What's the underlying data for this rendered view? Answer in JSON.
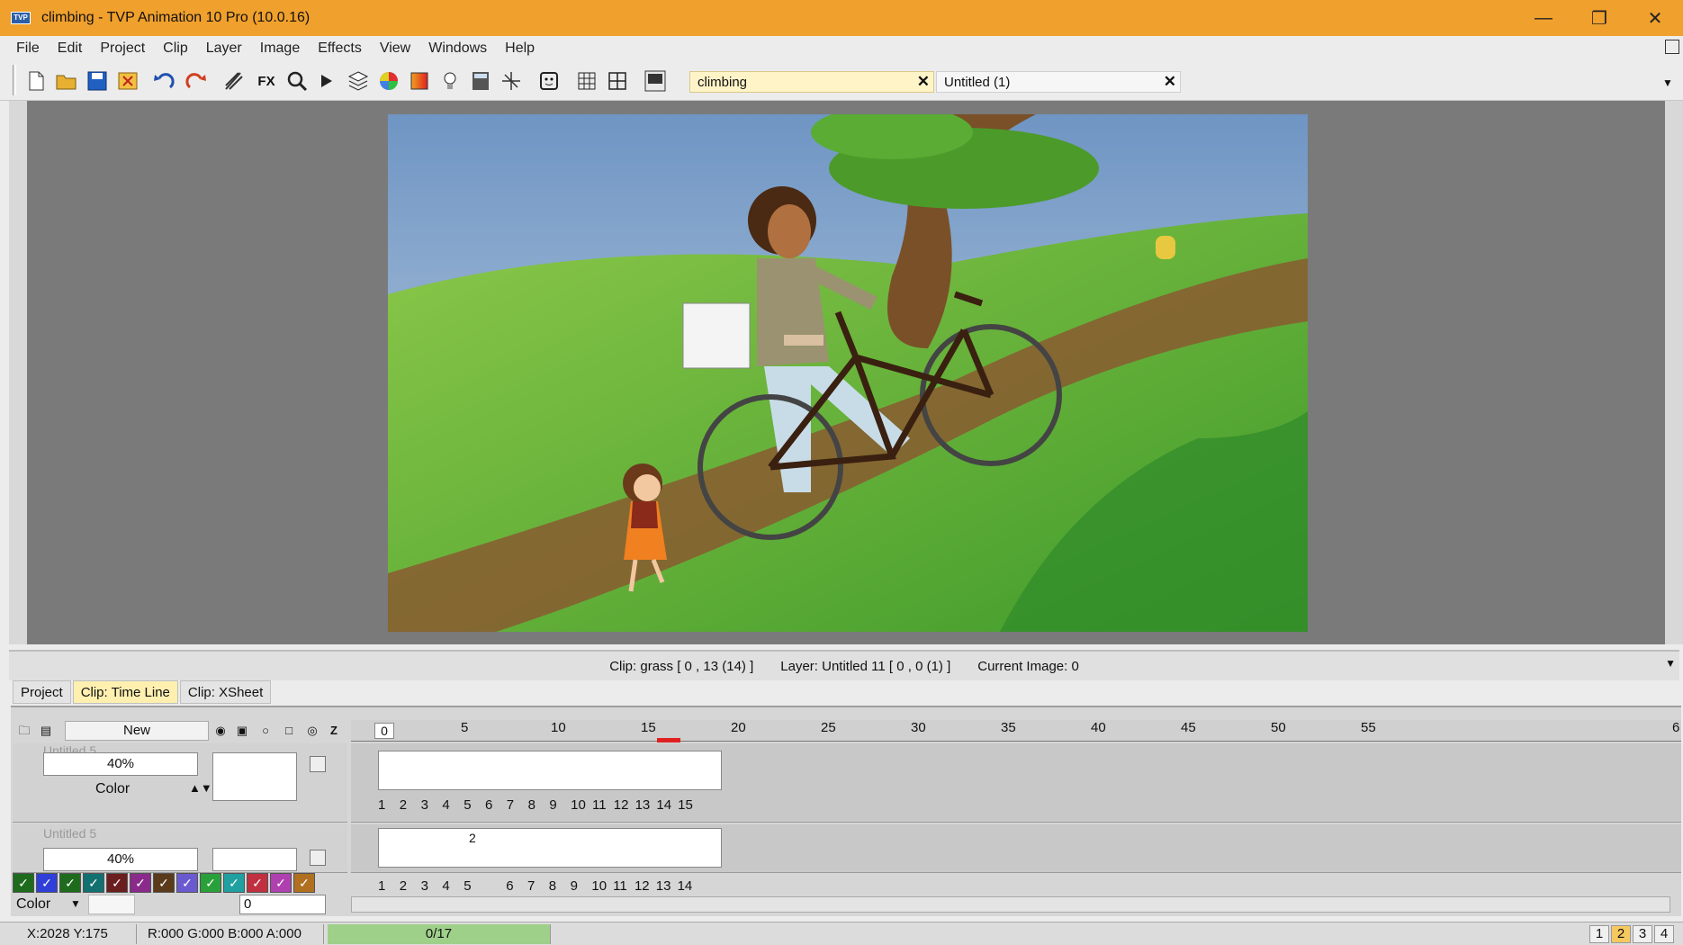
{
  "window": {
    "title": "climbing - TVP Animation 10 Pro (10.0.16)",
    "app_icon": "TVP"
  },
  "menu": [
    "File",
    "Edit",
    "Project",
    "Clip",
    "Layer",
    "Image",
    "Effects",
    "View",
    "Windows",
    "Help"
  ],
  "toolbar": {
    "icons": [
      "new-file-icon",
      "open-folder-icon",
      "save-icon",
      "close-file-icon",
      "undo-icon",
      "redo-icon",
      "brush-icon",
      "fx-icon",
      "zoom-icon",
      "play-icon",
      "layers-icon",
      "color-wheel-icon",
      "gradient-icon",
      "light-bulb-icon",
      "calculator-icon",
      "transform-icon",
      "face-icon",
      "grid-icon",
      "split-grid-icon",
      "monitor-icon"
    ],
    "fx_label": "FX",
    "tabs": [
      {
        "label": "climbing",
        "active": true
      },
      {
        "label": "Untitled (1)",
        "active": false
      }
    ],
    "close_glyph": "✕"
  },
  "infobar": {
    "clip": "Clip: grass [ 0 , 13  (14) ]",
    "layer": "Layer: Untitled 11 [ 0 , 0  (1) ]",
    "current": "Current Image: 0"
  },
  "panel_tabs": [
    "Project",
    "Clip: Time Line",
    "Clip: XSheet"
  ],
  "timeline": {
    "new_button": "New",
    "z_label": "Z",
    "current_frame": "0",
    "ruler_ticks": [
      "5",
      "10",
      "15",
      "20",
      "25",
      "30",
      "35",
      "40",
      "45",
      "50",
      "55",
      "6"
    ],
    "layers": [
      {
        "name": "Untitled 5",
        "opacity": "40%",
        "mode": "Color",
        "frames": [
          "1",
          "2",
          "3",
          "4",
          "5",
          "6",
          "7",
          "8",
          "9",
          "10",
          "11",
          "12",
          "13",
          "14",
          "15"
        ]
      },
      {
        "name": "Untitled 5",
        "opacity": "40%",
        "frame_label": "2",
        "frames": [
          "1",
          "2",
          "3",
          "4",
          "5",
          "6",
          "7",
          "8",
          "9",
          "10",
          "11",
          "12",
          "13",
          "14"
        ]
      }
    ],
    "swatches": [
      "#1e6b1e",
      "#2f3fd8",
      "#1e6b1e",
      "#137070",
      "#6b1e1e",
      "#8a2a8a",
      "#5a3a1a",
      "#6a5ad0",
      "#2aa03a",
      "#20a0a0",
      "#c03040",
      "#b040b0",
      "#b07020"
    ]
  },
  "color_row": {
    "label": "Color",
    "value": "0"
  },
  "status": {
    "coords": "X:2028  Y:175",
    "rgba": "R:000 G:000 B:000 A:000",
    "progress_text": "0/17",
    "progress_fraction": 0.0,
    "pages": [
      "1",
      "2",
      "3",
      "4"
    ],
    "active_page": "2"
  },
  "colors": {
    "titlebar": "#f0a02c",
    "active_tab": "#fff4c8",
    "progress": "#9fd08a"
  }
}
